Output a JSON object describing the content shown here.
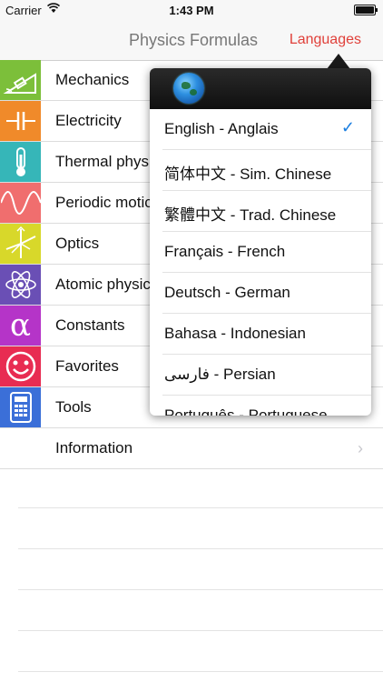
{
  "status_bar": {
    "carrier": "Carrier",
    "time": "1:43 PM"
  },
  "navbar": {
    "title": "Physics Formulas",
    "languages_label": "Languages"
  },
  "menu": {
    "items": [
      {
        "label": "Mechanics",
        "icon": "mechanics-icon",
        "tile_color": "#7cbf3a"
      },
      {
        "label": "Electricity",
        "icon": "capacitor-icon",
        "tile_color": "#f08a2a"
      },
      {
        "label": "Thermal phys",
        "icon": "thermometer-icon",
        "tile_color": "#36b6b8"
      },
      {
        "label": "Periodic motic",
        "icon": "wave-icon",
        "tile_color": "#f06e6e"
      },
      {
        "label": "Optics",
        "icon": "optics-icon",
        "tile_color": "#d8d82a"
      },
      {
        "label": "Atomic physic",
        "icon": "atom-icon",
        "tile_color": "#6a4fb5"
      },
      {
        "label": "Constants",
        "icon": "alpha-icon",
        "tile_color": "#b534c8"
      },
      {
        "label": "Favorites",
        "icon": "smiley-icon",
        "tile_color": "#e82c52"
      },
      {
        "label": "Tools",
        "icon": "calculator-icon",
        "tile_color": "#3b6fd8"
      },
      {
        "label": "Information",
        "icon": "information-icon",
        "tile_color": "#ffffff"
      }
    ]
  },
  "languages_popover": {
    "items": [
      {
        "label": "English - Anglais",
        "selected": true
      },
      {
        "label": "简体中文 - Sim. Chinese",
        "selected": false
      },
      {
        "label": "繁體中文 - Trad. Chinese",
        "selected": false
      },
      {
        "label": "Français - French",
        "selected": false
      },
      {
        "label": "Deutsch - German",
        "selected": false
      },
      {
        "label": "Bahasa - Indonesian",
        "selected": false
      },
      {
        "label": "فارسی - Persian",
        "selected": false
      },
      {
        "label": "Português - Portuguese",
        "selected": false
      }
    ],
    "check_mark": "✓"
  }
}
